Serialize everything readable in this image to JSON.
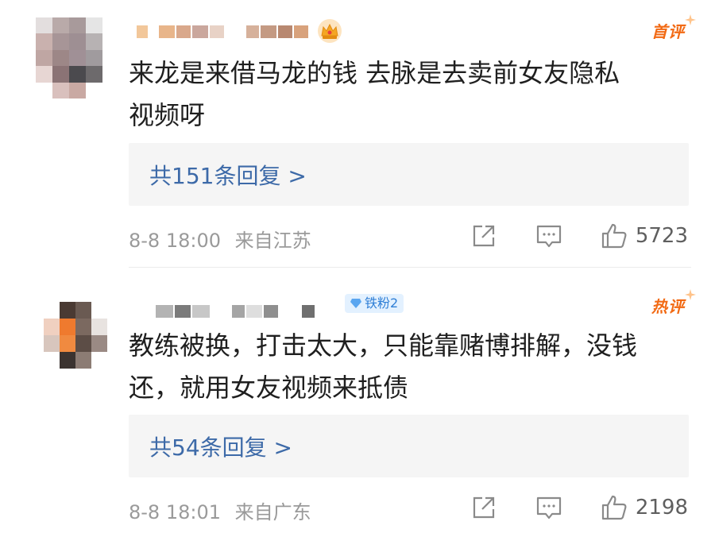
{
  "comments": [
    {
      "tag": "首评",
      "text": "来龙是来借马龙的钱 去脉是去卖前女友隐私\n视频呀",
      "reply_label": "共151条回复 >",
      "time": "8-8 18:00",
      "location": "来自江苏",
      "likes": "5723"
    },
    {
      "tag": "热评",
      "badge": "铁粉2",
      "text": "教练被换，打击太大，只能靠赌博排解，没钱\n还，就用女友视频来抵债",
      "reply_label": "共54条回复 >",
      "time": "8-8 18:01",
      "location": "来自广东",
      "likes": "2198"
    }
  ],
  "icons": {
    "share": "share-icon",
    "comment": "comment-icon",
    "like": "thumbs-up-icon",
    "crown": "crown-badge-icon",
    "fan": "diamond-icon"
  },
  "colors": {
    "tag_orange": "#f26a14",
    "link_blue": "#3d6aa8",
    "meta_gray": "#9a9a9a",
    "reply_bg": "#f5f5f5",
    "badge_bg": "#e3f1ff"
  }
}
